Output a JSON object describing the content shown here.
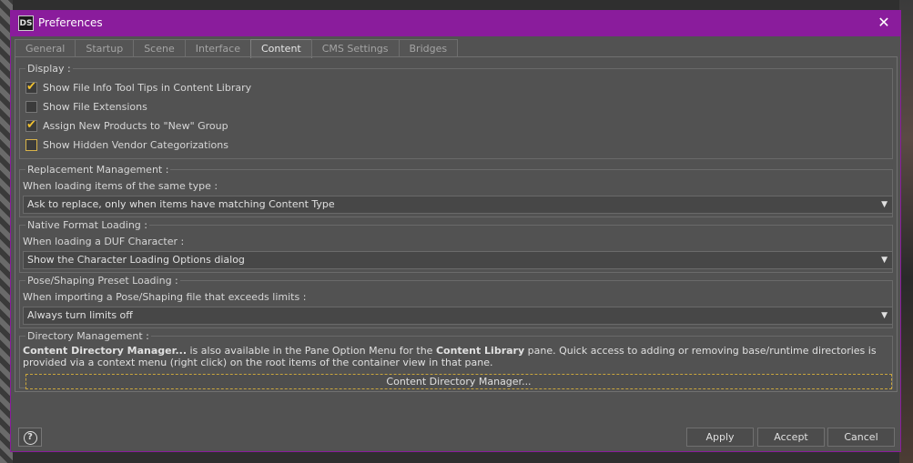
{
  "window": {
    "logo_text": "DS",
    "title": "Preferences",
    "close_glyph": "✕"
  },
  "tabs": [
    {
      "label": "General"
    },
    {
      "label": "Startup"
    },
    {
      "label": "Scene"
    },
    {
      "label": "Interface"
    },
    {
      "label": "Content",
      "active": true
    },
    {
      "label": "CMS Settings"
    },
    {
      "label": "Bridges"
    }
  ],
  "display": {
    "legend": "Display :",
    "options": [
      {
        "label": "Show File Info Tool Tips in Content Library",
        "checked": true
      },
      {
        "label": "Show File Extensions",
        "checked": false
      },
      {
        "label": "Assign New Products to \"New\" Group",
        "checked": true
      },
      {
        "label": "Show Hidden Vendor Categorizations",
        "checked": false
      }
    ]
  },
  "replacement": {
    "legend": "Replacement Management :",
    "field_label": "When loading items of the same type :",
    "selected": "Ask to replace, only when items have matching Content Type"
  },
  "native_format": {
    "legend": "Native Format Loading :",
    "field_label": "When loading a DUF Character :",
    "selected": "Show the Character Loading Options dialog"
  },
  "pose_shaping": {
    "legend": "Pose/Shaping Preset Loading :",
    "field_label": "When importing a Pose/Shaping file that exceeds limits :",
    "selected": "Always turn limits off"
  },
  "directory": {
    "legend": "Directory Management :",
    "desc_bold_1": "Content Directory Manager...",
    "desc_text_1": " is also available in the Pane Option Menu for the ",
    "desc_bold_2": "Content Library",
    "desc_text_2": " pane. Quick access to adding or removing base/runtime directories is provided via a context menu (right click) on the root items of the container view in that pane.",
    "button": "Content Directory Manager..."
  },
  "footer": {
    "help_glyph": "?",
    "apply": "Apply",
    "accept": "Accept",
    "cancel": "Cancel"
  },
  "colors": {
    "titlebar": "#8a1c9c",
    "check_accent": "#f2c230",
    "panel": "#525252"
  }
}
